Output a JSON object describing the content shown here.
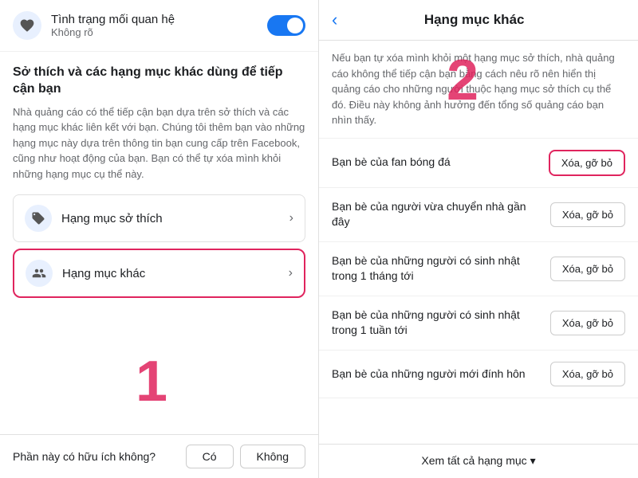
{
  "left": {
    "relationship": {
      "icon": "heart-icon",
      "title": "Tình trạng mối quan hệ",
      "subtitle": "Không rõ",
      "toggle_on": true
    },
    "heading": "Sở thích và các hạng mục khác dùng để tiếp cận bạn",
    "description": "Nhà quảng cáo có thể tiếp cận bạn dựa trên sở thích và các hạng mục khác liên kết với bạn. Chúng tôi thêm bạn vào những hạng mục này dựa trên thông tin bạn cung cấp trên Facebook, cũng như hoạt động của bạn. Bạn có thể tự xóa mình khỏi những hạng mục cụ thể này.",
    "categories": [
      {
        "id": "so-thich",
        "icon": "tag-icon",
        "label": "Hạng mục sở thích",
        "highlighted": false
      },
      {
        "id": "khac",
        "icon": "people-icon",
        "label": "Hạng mục khác",
        "highlighted": true
      }
    ],
    "feedback": {
      "question": "Phần này có hữu ích không?",
      "yes_label": "Có",
      "no_label": "Không"
    },
    "number_label": "1"
  },
  "right": {
    "back_label": "‹",
    "title": "Hạng mục khác",
    "description": "Nếu bạn tự xóa mình khỏi một hạng mục sở thích, nhà quảng cáo không thể tiếp cận bạn bằng cách nêu rõ nên hiển thị quảng cáo cho những người thuộc hạng mục sở thích cụ thể đó. Điều này không ảnh hưởng đến tổng số quảng cáo bạn nhìn thấy.",
    "items": [
      {
        "text": "Bạn bè của fan bóng đá",
        "btn_label": "Xóa, gỡ bỏ",
        "highlighted": true
      },
      {
        "text": "Bạn bè của người vừa chuyển nhà gần đây",
        "btn_label": "Xóa, gỡ bỏ",
        "highlighted": false
      },
      {
        "text": "Bạn bè của những người có sinh nhật trong 1 tháng tới",
        "btn_label": "Xóa, gỡ bỏ",
        "highlighted": false
      },
      {
        "text": "Bạn bè của những người có sinh nhật trong 1 tuần tới",
        "btn_label": "Xóa, gỡ bỏ",
        "highlighted": false
      },
      {
        "text": "Bạn bè của những người mới đính hôn",
        "btn_label": "Xóa, gỡ bỏ",
        "highlighted": false
      }
    ],
    "footer_label": "Xem tất cả hạng mục ▾",
    "number_label": "2"
  }
}
